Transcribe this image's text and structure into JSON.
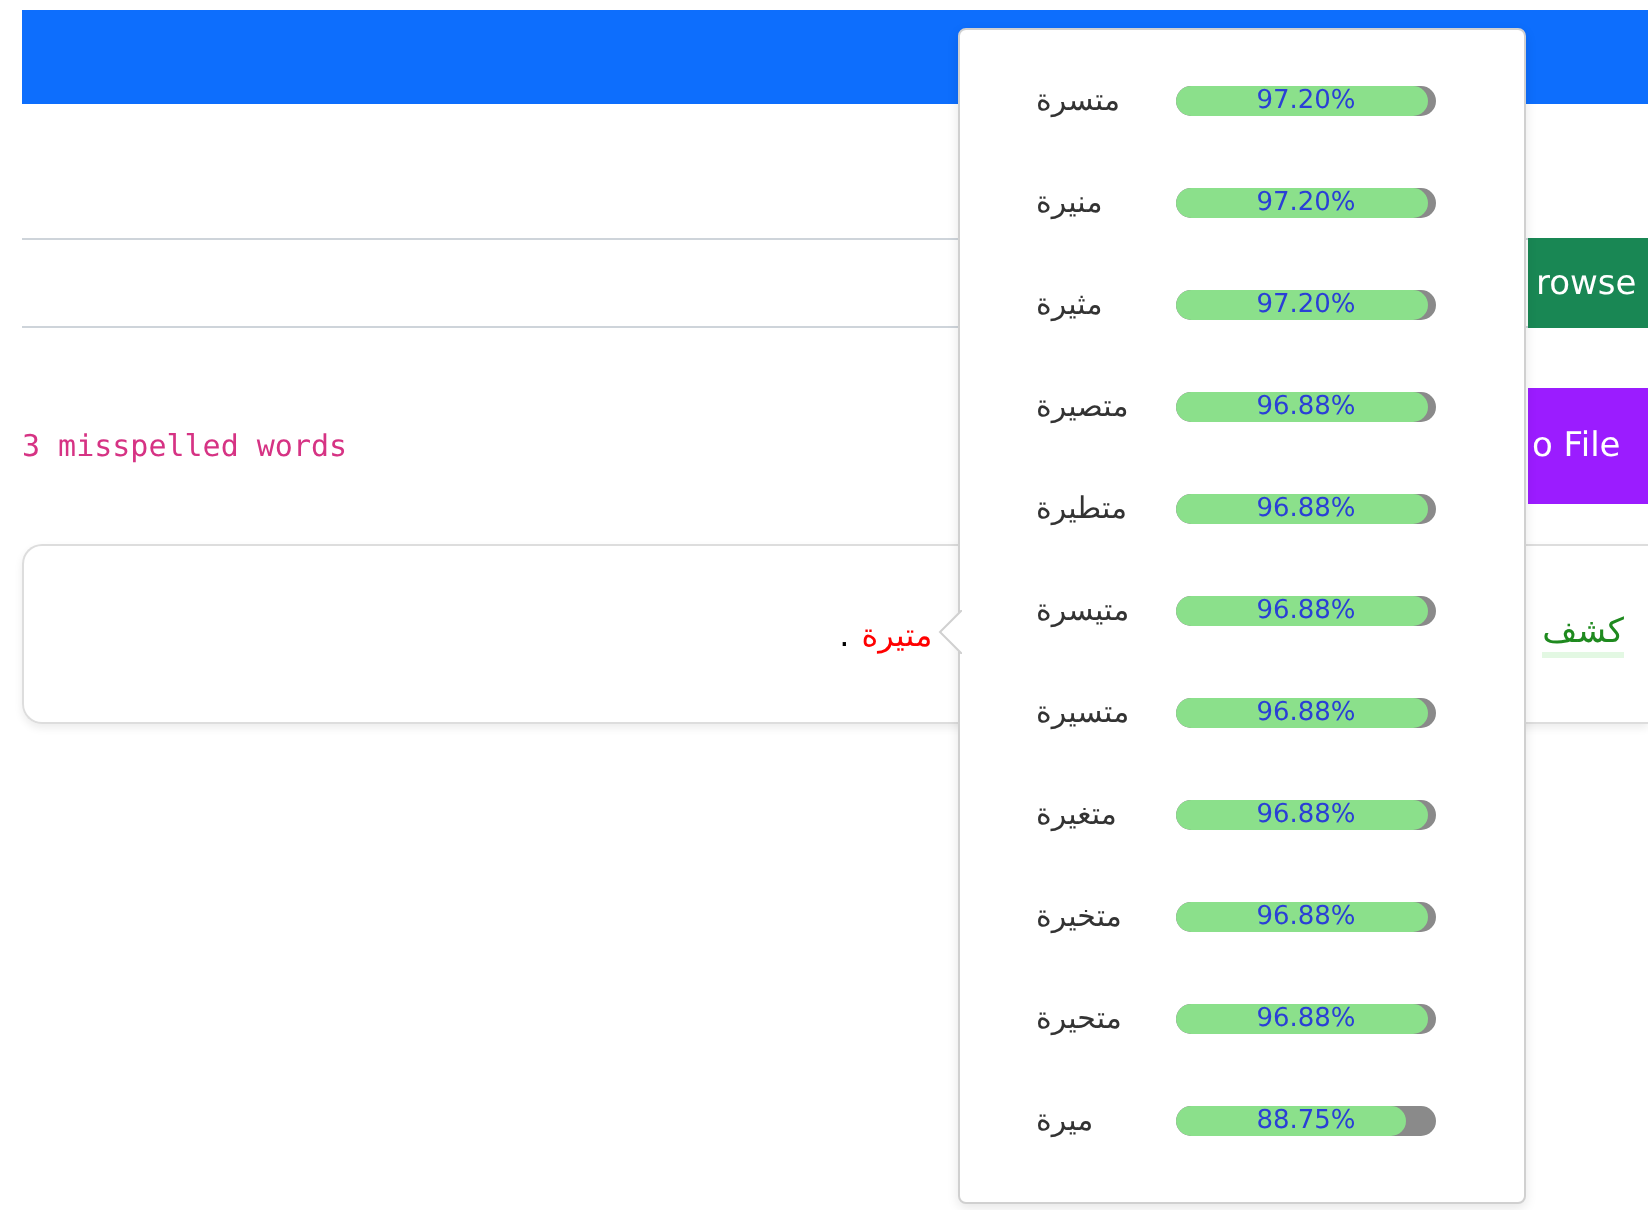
{
  "upload": {
    "browse_button": "rowse",
    "export_button": "o File"
  },
  "status": "3 misspelled words",
  "result": {
    "detected_word": "كشف",
    "misspelled_word": "متيرة",
    "end_mark": "."
  },
  "suggestions": [
    {
      "word": "متسرة",
      "score": "97.20%",
      "level": 0.972
    },
    {
      "word": "منيرة",
      "score": "97.20%",
      "level": 0.972
    },
    {
      "word": "مثيرة",
      "score": "97.20%",
      "level": 0.972
    },
    {
      "word": "متصيرة",
      "score": "96.88%",
      "level": 0.9688
    },
    {
      "word": "متطيرة",
      "score": "96.88%",
      "level": 0.9688
    },
    {
      "word": "متيسرة",
      "score": "96.88%",
      "level": 0.9688
    },
    {
      "word": "متسيرة",
      "score": "96.88%",
      "level": 0.9688
    },
    {
      "word": "متغيرة",
      "score": "96.88%",
      "level": 0.9688
    },
    {
      "word": "متخيرة",
      "score": "96.88%",
      "level": 0.9688
    },
    {
      "word": "متحيرة",
      "score": "96.88%",
      "level": 0.9688
    },
    {
      "word": "ميرة",
      "score": "88.75%",
      "level": 0.8875
    }
  ]
}
